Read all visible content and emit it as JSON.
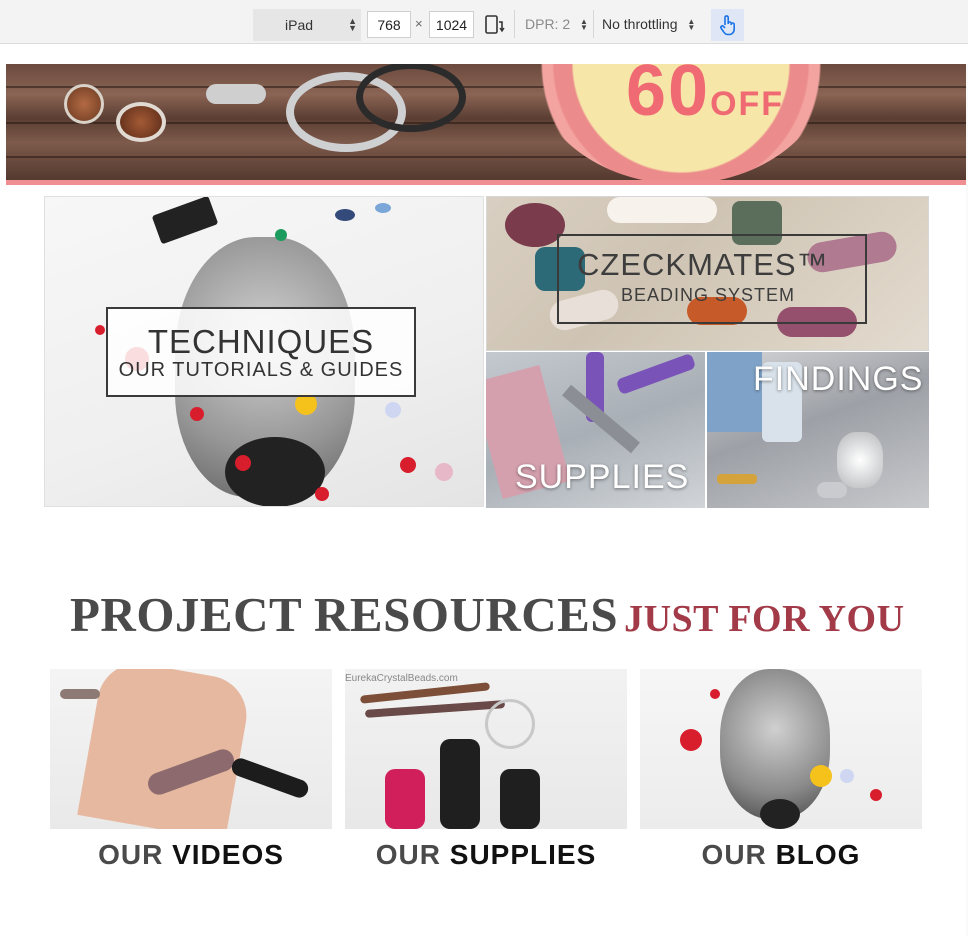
{
  "devtools": {
    "device": "iPad",
    "width": "768",
    "times": "×",
    "height": "1024",
    "dpr": "DPR: 2",
    "throttle": "No throttling"
  },
  "banner": {
    "badge_big": "60",
    "badge_small": "OFF"
  },
  "tiles": {
    "techniques": {
      "title": "TECHNIQUES",
      "subtitle": "OUR TUTORIALS & GUIDES"
    },
    "czeckmates": {
      "title": "CZECKMATES™",
      "subtitle": "BEADING SYSTEM"
    },
    "supplies": {
      "title": "SUPPLIES"
    },
    "findings": {
      "title": "FINDINGS"
    }
  },
  "resources": {
    "title_main": "PROJECT RESOURCES",
    "title_accent": "JUST FOR YOU",
    "cards": [
      {
        "prefix": "OUR",
        "name": "VIDEOS"
      },
      {
        "prefix": "OUR",
        "name": "SUPPLIES",
        "watermark": "EurekaCrystalBeads.com"
      },
      {
        "prefix": "OUR",
        "name": "BLOG"
      }
    ]
  },
  "colors": {
    "accent": "#a23a48",
    "heading": "#4a4a4a",
    "banner_pink": "#ef8f92"
  }
}
